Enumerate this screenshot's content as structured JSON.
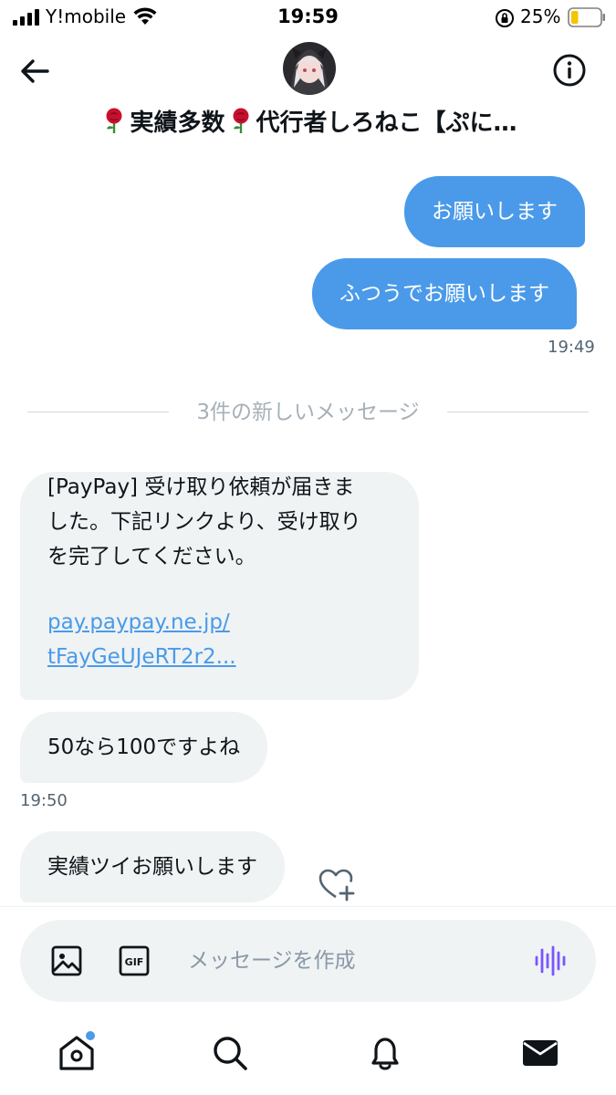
{
  "status_bar": {
    "carrier": "Y!mobile",
    "time": "19:59",
    "battery_percent": "25%",
    "battery_level": 0.25,
    "icons": [
      "signal-icon",
      "wifi-icon",
      "orientation-lock-icon",
      "battery-icon"
    ]
  },
  "header": {
    "title_text": "実績多数",
    "title_text_2": "代行者しろねこ【ぷに…",
    "emoji": "rose",
    "icons": [
      "back-arrow-icon",
      "avatar",
      "info-icon"
    ]
  },
  "messages": {
    "out_1": "お願いします",
    "out_2": "ふつうでお願いします",
    "time_1": "19:49",
    "unread_divider": "3件の新しいメッセージ",
    "in_1_lines": [
      "[PayPay] 受け取り依頼が届きま",
      "した。下記リンクより、受け取り",
      "を完了してください。"
    ],
    "in_1_link_lines": [
      "pay.paypay.ne.jp/",
      "tFayGeUJeRT2r2..."
    ],
    "in_2": "50なら100ですよね",
    "time_2": "19:50",
    "in_3": "実績ツイお願いします"
  },
  "composer": {
    "placeholder": "メッセージを作成",
    "value": "",
    "icons": [
      "image-icon",
      "gif-icon",
      "voice-icon"
    ]
  },
  "tabbar": {
    "tabs": [
      "home",
      "search",
      "notifications",
      "messages"
    ],
    "home_has_dot": true
  },
  "colors": {
    "accent": "#4a9ae9",
    "bubble_in": "#eff3f4",
    "text": "#0f1419",
    "muted": "#536471",
    "voice": "#7856ff"
  }
}
